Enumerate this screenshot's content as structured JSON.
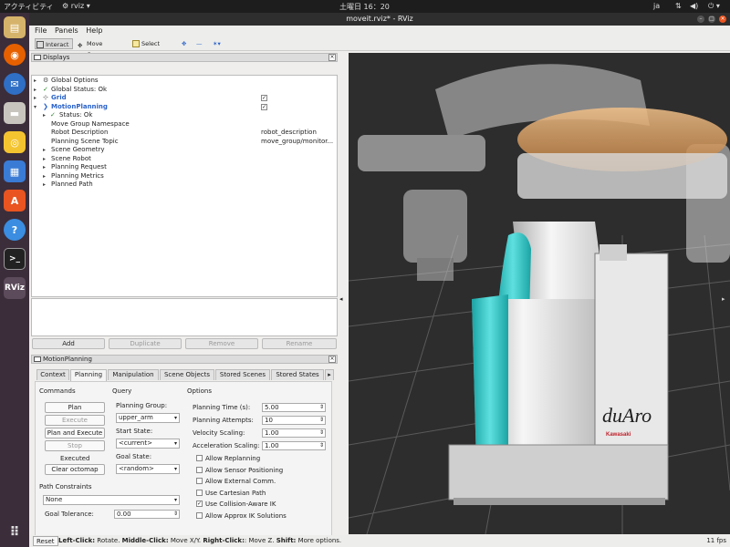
{
  "topbar": {
    "activities": "アクティビティ",
    "app": "rviz",
    "clock": "土曜日 16：20",
    "lang": "ja",
    "icons": [
      "network-icon",
      "volume-icon",
      "power-icon"
    ]
  },
  "dock": {
    "items": [
      "files-icon",
      "firefox-icon",
      "thunderbird-icon",
      "file-manager-icon",
      "rhythmbox-icon",
      "libreoffice-icon",
      "software-icon",
      "help-icon",
      "terminal-icon",
      "rviz-icon",
      "apps-grid-icon"
    ],
    "rviz_label": "RViz",
    "terminal_label": ">_"
  },
  "window": {
    "title": "moveit.rviz* - RViz"
  },
  "menu": {
    "file": "File",
    "panels": "Panels",
    "help": "Help"
  },
  "toolbar": {
    "interact": "Interact",
    "move_camera": "Move Camera",
    "select": "Select"
  },
  "displays": {
    "header": "Displays",
    "rows": [
      {
        "label": "Global Options"
      },
      {
        "label": "Global Status: Ok"
      },
      {
        "label": "Grid",
        "checked": true
      },
      {
        "label": "MotionPlanning",
        "checked": true
      },
      {
        "label": "Status: Ok"
      },
      {
        "label": "Move Group Namespace",
        "value": ""
      },
      {
        "label": "Robot Description",
        "value": "robot_description"
      },
      {
        "label": "Planning Scene Topic",
        "value": "move_group/monitor..."
      },
      {
        "label": "Scene Geometry"
      },
      {
        "label": "Scene Robot"
      },
      {
        "label": "Planning Request"
      },
      {
        "label": "Planning Metrics"
      },
      {
        "label": "Planned Path"
      }
    ],
    "buttons": {
      "add": "Add",
      "duplicate": "Duplicate",
      "remove": "Remove",
      "rename": "Rename"
    }
  },
  "motion_planning": {
    "header": "MotionPlanning",
    "tabs": [
      "Context",
      "Planning",
      "Manipulation",
      "Scene Objects",
      "Stored Scenes",
      "Stored States"
    ],
    "commands_title": "Commands",
    "buttons": {
      "plan": "Plan",
      "execute": "Execute",
      "plan_execute": "Plan and Execute",
      "stop": "Stop",
      "executed": "Executed",
      "clear_octomap": "Clear octomap"
    },
    "query_title": "Query",
    "planning_group_label": "Planning Group:",
    "planning_group": "upper_arm",
    "start_state_label": "Start State:",
    "start_state": "<current>",
    "goal_state_label": "Goal State:",
    "goal_state": "<random>",
    "options_title": "Options",
    "planning_time_label": "Planning Time (s):",
    "planning_time": "5.00",
    "planning_attempts_label": "Planning Attempts:",
    "planning_attempts": "10",
    "velocity_scaling_label": "Velocity Scaling:",
    "velocity_scaling": "1.00",
    "acceleration_scaling_label": "Acceleration Scaling:",
    "acceleration_scaling": "1.00",
    "checkboxes": [
      {
        "label": "Allow Replanning",
        "checked": false
      },
      {
        "label": "Allow Sensor Positioning",
        "checked": false
      },
      {
        "label": "Allow External Comm.",
        "checked": false
      },
      {
        "label": "Use Cartesian Path",
        "checked": false
      },
      {
        "label": "Use Collision-Aware IK",
        "checked": true
      },
      {
        "label": "Allow Approx IK Solutions",
        "checked": false
      }
    ],
    "path_constraints_label": "Path Constraints",
    "path_constraints": "None",
    "goal_tolerance_label": "Goal Tolerance:",
    "goal_tolerance": "0.00"
  },
  "viewport": {
    "robot_logo": "duAro",
    "brand": "Kawasaki"
  },
  "status": {
    "reset": "Reset",
    "left_click": "Left-Click:",
    "left_txt": " Rotate. ",
    "middle_click": "Middle-Click:",
    "middle_txt": " Move X/Y. ",
    "right_click": "Right-Click:",
    "right_txt": ": Move Z. ",
    "shift": "Shift:",
    "shift_txt": " More options.",
    "fps": "11 fps"
  }
}
